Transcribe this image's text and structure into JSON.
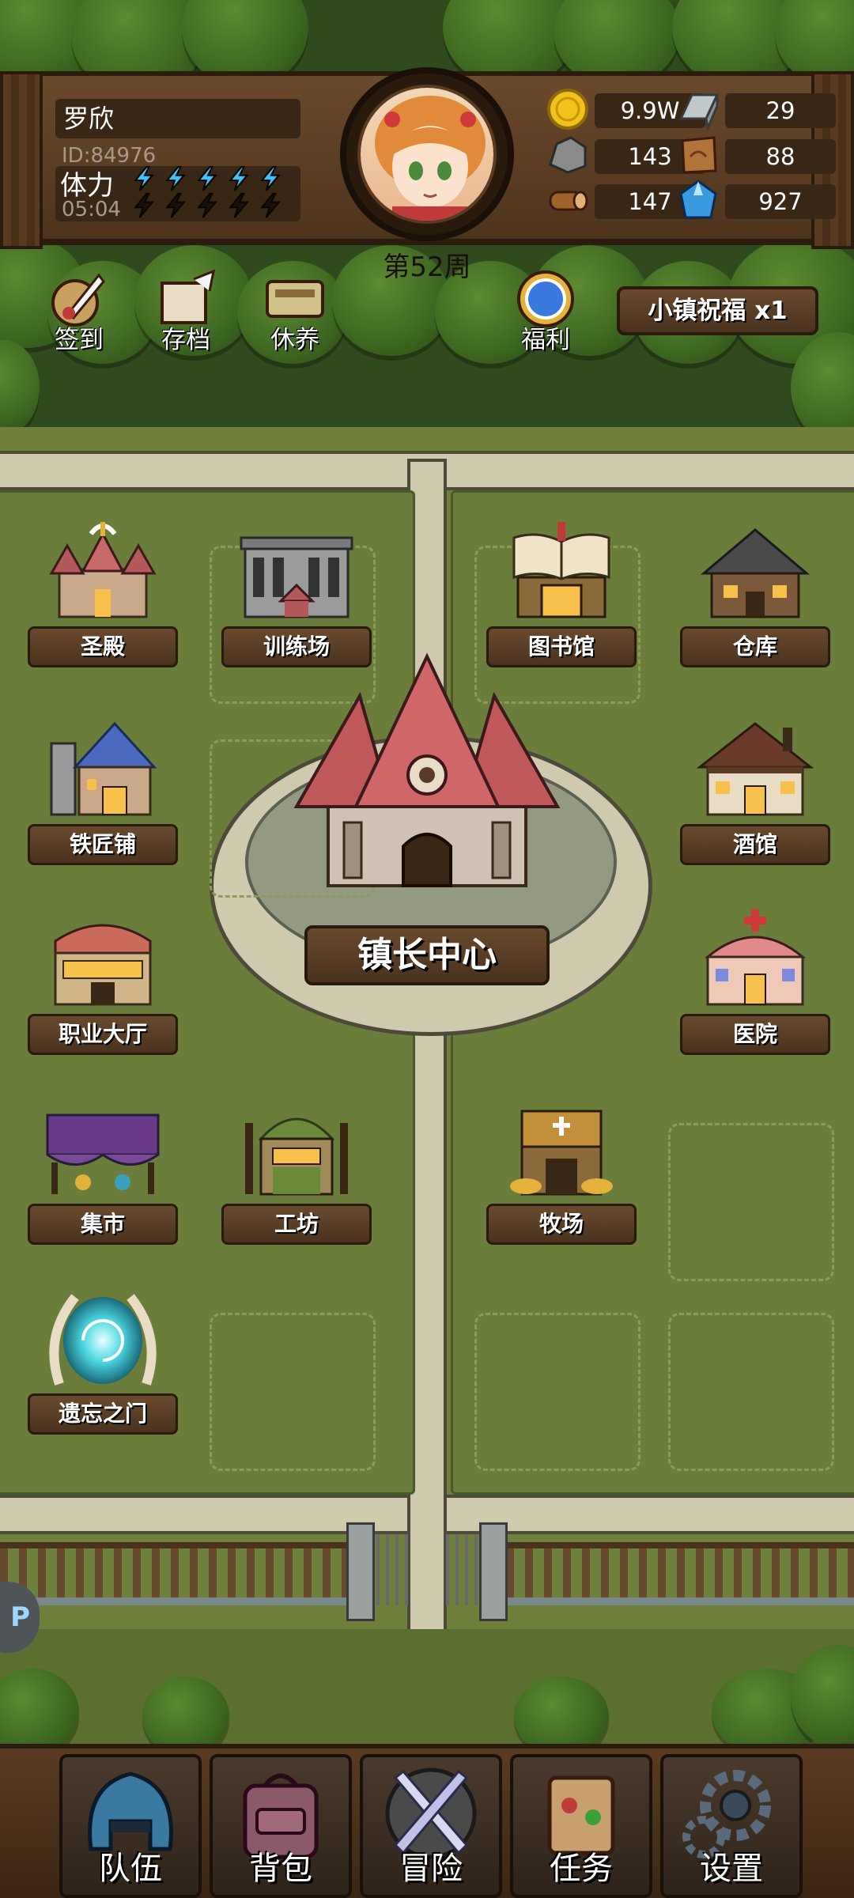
{
  "player": {
    "name": "罗欣",
    "id_text": "ID:84976",
    "stamina_label": "体力",
    "stamina_timer": "05:04",
    "stamina_filled": 5,
    "stamina_max": 10,
    "week": "第52周"
  },
  "resources": [
    {
      "icon": "gold-coin-icon",
      "value": "9.9W"
    },
    {
      "icon": "iron-ingot-icon",
      "value": "29"
    },
    {
      "icon": "stone-icon",
      "value": "143"
    },
    {
      "icon": "leather-icon",
      "value": "88"
    },
    {
      "icon": "wood-log-icon",
      "value": "147"
    },
    {
      "icon": "crystal-icon",
      "value": "927"
    }
  ],
  "quick_actions": [
    {
      "icon": "quill-icon",
      "label": "签到"
    },
    {
      "icon": "scroll-icon",
      "label": "存档"
    },
    {
      "icon": "sign-icon",
      "label": "休养"
    },
    {
      "icon": "shield-icon",
      "label": "福利"
    }
  ],
  "blessing": "小镇祝福 x1",
  "buildings": {
    "holy_hall": "圣殿",
    "training_ground": "训练场",
    "library": "图书馆",
    "warehouse": "仓库",
    "blacksmith": "铁匠铺",
    "tavern": "酒馆",
    "town_hall": "镇长中心",
    "job_hall": "职业大厅",
    "hospital": "医院",
    "market": "集市",
    "workshop": "工坊",
    "ranch": "牧场",
    "forgotten_gate": "遗忘之门"
  },
  "side_tab": "P",
  "nav": [
    {
      "icon": "helmet-icon",
      "label": "队伍"
    },
    {
      "icon": "backpack-icon",
      "label": "背包"
    },
    {
      "icon": "crossed-swords-icon",
      "label": "冒险"
    },
    {
      "icon": "quest-scroll-icon",
      "label": "任务"
    },
    {
      "icon": "gear-icon",
      "label": "设置"
    }
  ],
  "colors": {
    "wood": "#5a3b21",
    "lightning": "#3fc3ff",
    "label_bg": "#4a321d"
  }
}
